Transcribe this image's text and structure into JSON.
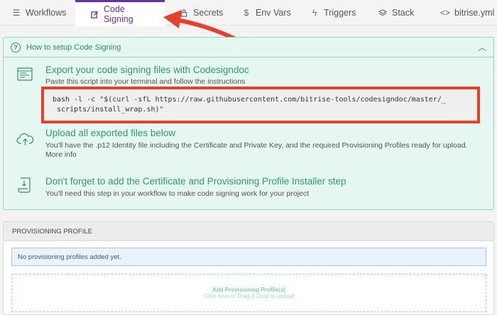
{
  "tabs": [
    {
      "label": "Workflows",
      "icon": "list-icon"
    },
    {
      "label": "Code Signing",
      "icon": "edit-icon",
      "active": true
    },
    {
      "label": "Secrets",
      "icon": "lock-icon"
    },
    {
      "label": "Env Vars",
      "icon": "dollar-icon"
    },
    {
      "label": "Triggers",
      "icon": "lightning-icon"
    },
    {
      "label": "Stack",
      "icon": "layers-icon"
    },
    {
      "label": "bitrise.yml",
      "icon": "code-icon"
    }
  ],
  "setup": {
    "header": "How to setup Code Signing",
    "steps": [
      {
        "title": "Export your code signing files with Codesigndoc",
        "desc": "Paste this script into your terminal and follow the instructions",
        "code": "bash -l -c \"$(curl -sfL https://raw.githubusercontent.com/bitrise-tools/codesigndoc/master/_\n scripts/install_wrap.sh)\""
      },
      {
        "title": "Upload all exported files below",
        "desc": "You'll have the .p12 Identity file including the Certificate and Private Key, and the required Provisioning Profiles ready for upload.",
        "link": "More info"
      },
      {
        "title": "Don't forget to add the Certificate and Provisioning Profile Installer step",
        "desc": "You'll need this step in your workflow to make code signing work for your project"
      }
    ]
  },
  "provisioning": {
    "header": "PROVISIONING PROFILE",
    "empty_message": "No provisioning profiles added yet.",
    "dropzone_title": "Add Provisioning Profile(s)",
    "dropzone_sub": "Click here or Drag & Drop to upload"
  },
  "colors": {
    "accent": "#6c2db0",
    "green": "#2d9b75",
    "highlight": "#e8402a"
  }
}
